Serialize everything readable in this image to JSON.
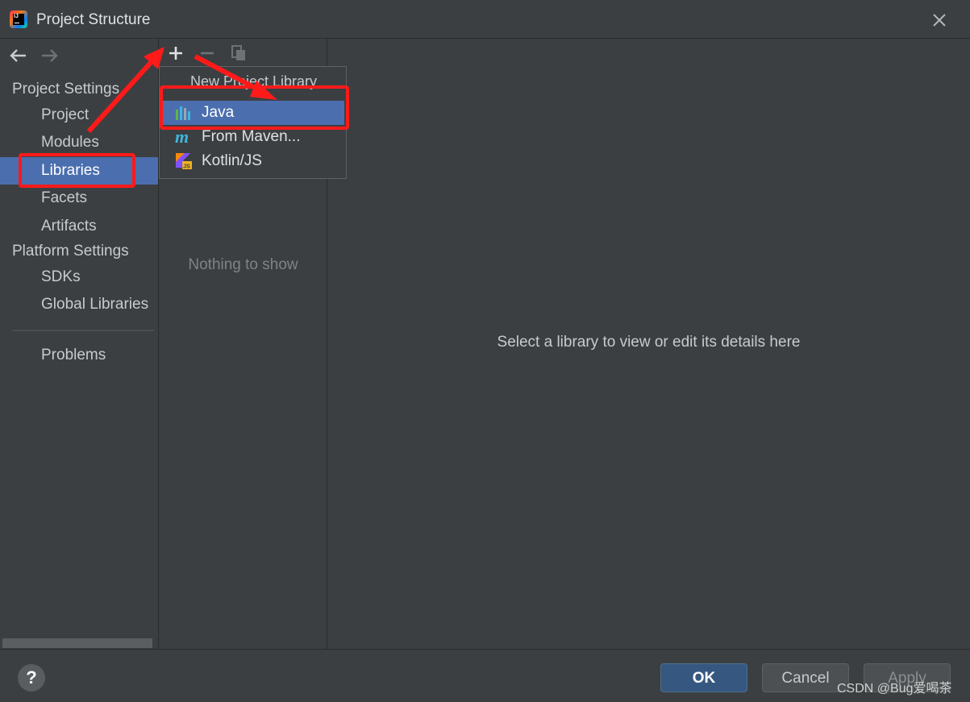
{
  "window": {
    "title": "Project Structure",
    "app_icon": "intellij-idea-icon",
    "app_icon_text": "IJ"
  },
  "sidebar": {
    "sections": [
      {
        "label": "Project Settings"
      },
      {
        "label": "Platform Settings"
      }
    ],
    "items": [
      {
        "label": "Project",
        "selected": false
      },
      {
        "label": "Modules",
        "selected": false
      },
      {
        "label": "Libraries",
        "selected": true
      },
      {
        "label": "Facets",
        "selected": false
      },
      {
        "label": "Artifacts",
        "selected": false
      },
      {
        "label": "SDKs",
        "selected": false
      },
      {
        "label": "Global Libraries",
        "selected": false
      },
      {
        "label": "Problems",
        "selected": false
      }
    ]
  },
  "middle": {
    "toolbar": [
      "add-icon",
      "remove-icon",
      "copy-icon"
    ],
    "empty_text": "Nothing to show"
  },
  "popup": {
    "title": "New Project Library",
    "items": [
      {
        "label": "Java",
        "icon": "java-library-icon",
        "selected": true
      },
      {
        "label": "From Maven...",
        "icon": "maven-icon",
        "selected": false
      },
      {
        "label": "Kotlin/JS",
        "icon": "kotlin-js-icon",
        "selected": false
      }
    ]
  },
  "detail": {
    "message": "Select a library to view or edit its details here"
  },
  "footer": {
    "help": "?",
    "ok": "OK",
    "cancel": "Cancel",
    "apply": "Apply"
  },
  "watermark": "CSDN @Bug爱喝茶",
  "colors": {
    "background": "#3c3f41",
    "selection": "#4b6eaf",
    "ok_button": "#365880",
    "annotation": "#ff1a1a"
  }
}
